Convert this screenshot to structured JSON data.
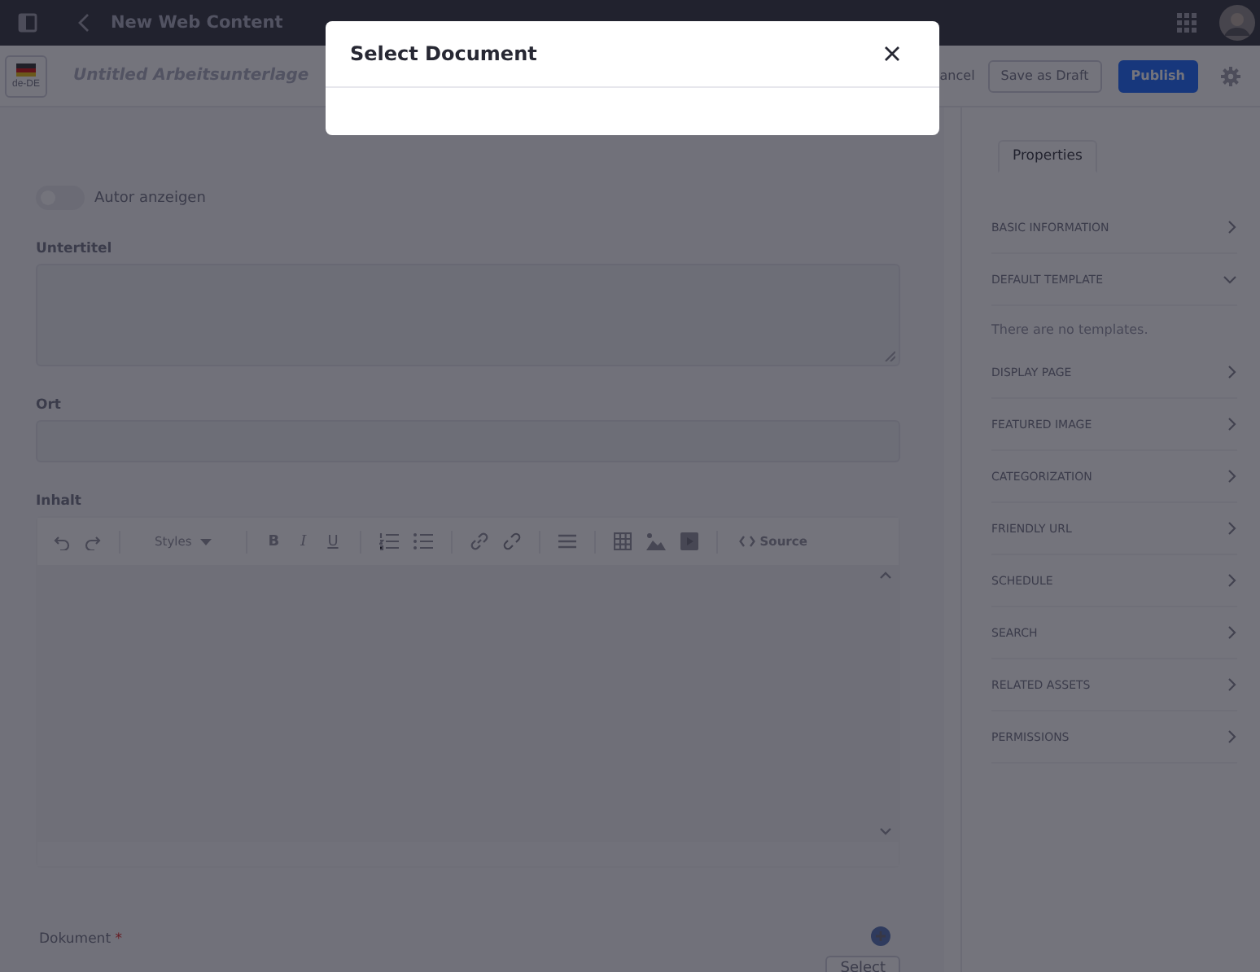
{
  "topbar": {
    "title": "New Web Content"
  },
  "header": {
    "locale": "de-DE",
    "title": "Untitled Arbeitsunterlage",
    "buttons": [
      {
        "label": "ancel",
        "kind": "link"
      },
      {
        "label": "Save as Draft",
        "kind": "secondary"
      },
      {
        "label": "Publish",
        "kind": "primary"
      }
    ]
  },
  "form": {
    "toggle": {
      "label": "Autor anzeigen",
      "on": false
    },
    "fields": [
      {
        "label": "Untertitel",
        "kind": "textarea"
      },
      {
        "label": "Ort",
        "kind": "input"
      }
    ],
    "editor": {
      "label": "Inhalt",
      "toolbar": [
        {
          "kind": "undo"
        },
        {
          "kind": "redo"
        },
        {
          "kind": "sep"
        },
        {
          "kind": "styles",
          "label": "Styles"
        },
        {
          "kind": "sep"
        },
        {
          "kind": "bold",
          "label": "B"
        },
        {
          "kind": "italic",
          "label": "I"
        },
        {
          "kind": "underline",
          "label": "U"
        },
        {
          "kind": "sep"
        },
        {
          "kind": "ol"
        },
        {
          "kind": "ul"
        },
        {
          "kind": "sep"
        },
        {
          "kind": "link"
        },
        {
          "kind": "unlink"
        },
        {
          "kind": "sep"
        },
        {
          "kind": "align"
        },
        {
          "kind": "sep"
        },
        {
          "kind": "table"
        },
        {
          "kind": "image"
        },
        {
          "kind": "video"
        },
        {
          "kind": "sep"
        },
        {
          "kind": "source",
          "label": "Source"
        }
      ]
    },
    "document": {
      "label": "Dokument",
      "required_mark": "*",
      "button": "Select"
    }
  },
  "sidebar": {
    "tabs": [
      {
        "label": "Properties",
        "selected": true
      }
    ],
    "sections": [
      {
        "label": "BASIC INFORMATION",
        "expanded": false
      },
      {
        "label": "DEFAULT TEMPLATE",
        "expanded": true,
        "content": "There are no templates."
      },
      {
        "label": "DISPLAY PAGE",
        "expanded": false
      },
      {
        "label": "FEATURED IMAGE",
        "expanded": false
      },
      {
        "label": "CATEGORIZATION",
        "expanded": false
      },
      {
        "label": "FRIENDLY URL",
        "expanded": false
      },
      {
        "label": "SCHEDULE",
        "expanded": false
      },
      {
        "label": "SEARCH",
        "expanded": false
      },
      {
        "label": "RELATED ASSETS",
        "expanded": false
      },
      {
        "label": "PERMISSIONS",
        "expanded": false
      }
    ]
  },
  "modal": {
    "title": "Select Document"
  }
}
